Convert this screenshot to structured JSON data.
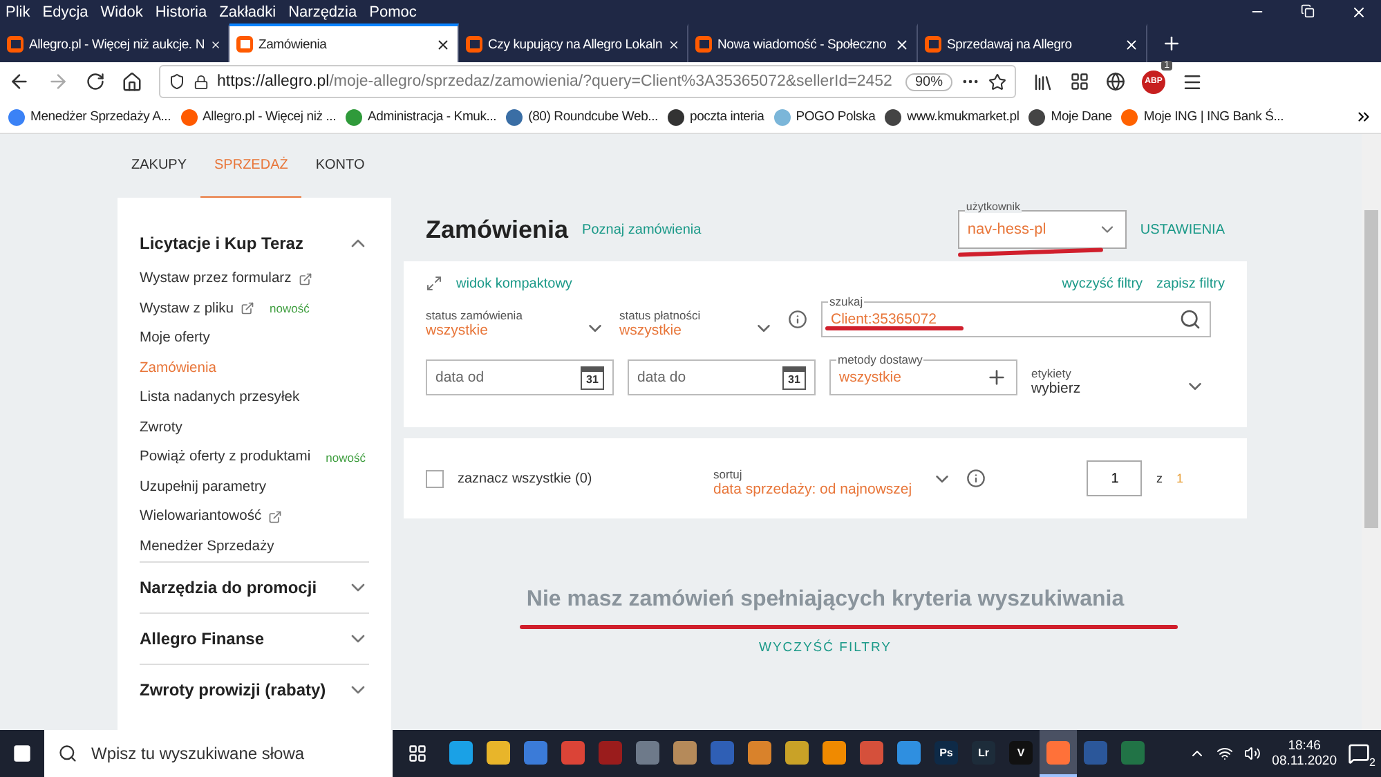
{
  "menu": [
    "Plik",
    "Edycja",
    "Widok",
    "Historia",
    "Zakładki",
    "Narzędzia",
    "Pomoc"
  ],
  "browser_tabs": [
    {
      "title": "Allegro.pl - Więcej niż aukcje. N",
      "selected": false
    },
    {
      "title": "Zamówienia",
      "selected": true
    },
    {
      "title": "Czy kupujący na Allegro Lokaln",
      "selected": false
    },
    {
      "title": "Nowa wiadomość - Społeczno",
      "selected": false
    },
    {
      "title": "Sprzedawaj na Allegro",
      "selected": false
    }
  ],
  "address": {
    "url_host": "https://allegro.pl",
    "url_path": "/moje-allegro/sprzedaz/zamowienia/?query=Client%3A35365072&sellerId=2452",
    "zoom": "90%",
    "addon_count": "1",
    "adblock": "ABP"
  },
  "bookmarks": [
    {
      "label": "Menedżer Sprzedaży A...",
      "kind": "wave"
    },
    {
      "label": "Allegro.pl - Więcej niż ...",
      "kind": "allegro"
    },
    {
      "label": "Administracja - Kmuk...",
      "kind": "leaf"
    },
    {
      "label": "(80) Roundcube Web...",
      "kind": "cloud"
    },
    {
      "label": "poczta interia",
      "kind": "int"
    },
    {
      "label": "POGO Polska",
      "kind": "pogo"
    },
    {
      "label": "www.kmukmarket.pl",
      "kind": "globe"
    },
    {
      "label": "Moje Dane",
      "kind": "globe"
    },
    {
      "label": "Moje ING | ING Bank Ś...",
      "kind": "ing"
    }
  ],
  "page_nav": [
    {
      "label": "ZAKUPY",
      "selected": false
    },
    {
      "label": "SPRZEDAŻ",
      "selected": true
    },
    {
      "label": "KONTO",
      "selected": false
    }
  ],
  "sidebar": [
    {
      "title": "Licytacje i Kup Teraz",
      "expanded": true,
      "items": [
        {
          "label": "Wystaw przez formularz",
          "external": true,
          "selected": false
        },
        {
          "label": "Wystaw z pliku",
          "external": true,
          "badge": "nowość",
          "selected": false
        },
        {
          "label": "Moje oferty",
          "selected": false
        },
        {
          "label": "Zamówienia",
          "selected": true
        },
        {
          "label": "Lista nadanych przesyłek",
          "selected": false
        },
        {
          "label": "Zwroty",
          "selected": false
        },
        {
          "label": "Powiąż oferty z produktami",
          "badge": "nowość",
          "selected": false
        },
        {
          "label": "Uzupełnij parametry",
          "selected": false
        },
        {
          "label": "Wielowariantowość",
          "external": true,
          "selected": false
        },
        {
          "label": "Menedżer Sprzedaży",
          "selected": false
        }
      ]
    },
    {
      "title": "Narzędzia do promocji",
      "expanded": false
    },
    {
      "title": "Allegro Finanse",
      "expanded": false
    },
    {
      "title": "Zwroty prowizji (rabaty)",
      "expanded": false
    }
  ],
  "header": {
    "title": "Zamówienia",
    "link": "Poznaj zamówienia",
    "user_label": "użytkownik",
    "user_value": "nav-hess-pl",
    "settings": "USTAWIENIA"
  },
  "filters": {
    "compact": "widok kompaktowy",
    "clear": "wyczyść filtry",
    "save": "zapisz filtry",
    "order_status": {
      "label": "status zamówienia",
      "value": "wszystkie"
    },
    "payment_status": {
      "label": "status płatności",
      "value": "wszystkie"
    },
    "search": {
      "label": "szukaj",
      "value": "Client:35365072"
    },
    "date_from": {
      "placeholder": "data od",
      "day": "31"
    },
    "date_to": {
      "placeholder": "data do",
      "day": "31"
    },
    "delivery": {
      "label": "metody dostawy",
      "value": "wszystkie"
    },
    "tags": {
      "label": "etykiety",
      "value": "wybierz"
    }
  },
  "list_bar": {
    "select_all": "zaznacz wszystkie (0)",
    "checked": false,
    "sort_label": "sortuj",
    "sort_value": "data sprzedaży: od najnowszej",
    "page": "1",
    "of": "z",
    "pages": "1"
  },
  "empty": {
    "message": "Nie masz zamówień spełniających kryteria wyszukiwania",
    "clear": "WYCZYŚĆ FILTRY"
  },
  "taskbar": {
    "search_placeholder": "Wpisz tu wyszukiwane słowa",
    "apps": [
      {
        "kind": "edge",
        "active": false
      },
      {
        "kind": "folder",
        "active": false
      },
      {
        "kind": "store",
        "active": false
      },
      {
        "kind": "chrome",
        "active": false
      },
      {
        "kind": "red",
        "active": false
      },
      {
        "kind": "calc",
        "active": false
      },
      {
        "kind": "disc",
        "active": false
      },
      {
        "kind": "save",
        "active": false
      },
      {
        "kind": "orange",
        "active": false
      },
      {
        "kind": "yellow",
        "active": false
      },
      {
        "kind": "vlc",
        "active": false
      },
      {
        "kind": "photo",
        "active": false
      },
      {
        "kind": "bolt",
        "active": false
      },
      {
        "kind": "ps",
        "label": "Ps",
        "active": false
      },
      {
        "kind": "lr",
        "label": "Lr",
        "active": false
      },
      {
        "kind": "v",
        "label": "V",
        "active": false
      },
      {
        "kind": "firefox",
        "active": true
      },
      {
        "kind": "word",
        "active": false
      },
      {
        "kind": "excel",
        "active": false
      }
    ],
    "time": "18:46",
    "date": "08.11.2020",
    "notifications": "2"
  }
}
